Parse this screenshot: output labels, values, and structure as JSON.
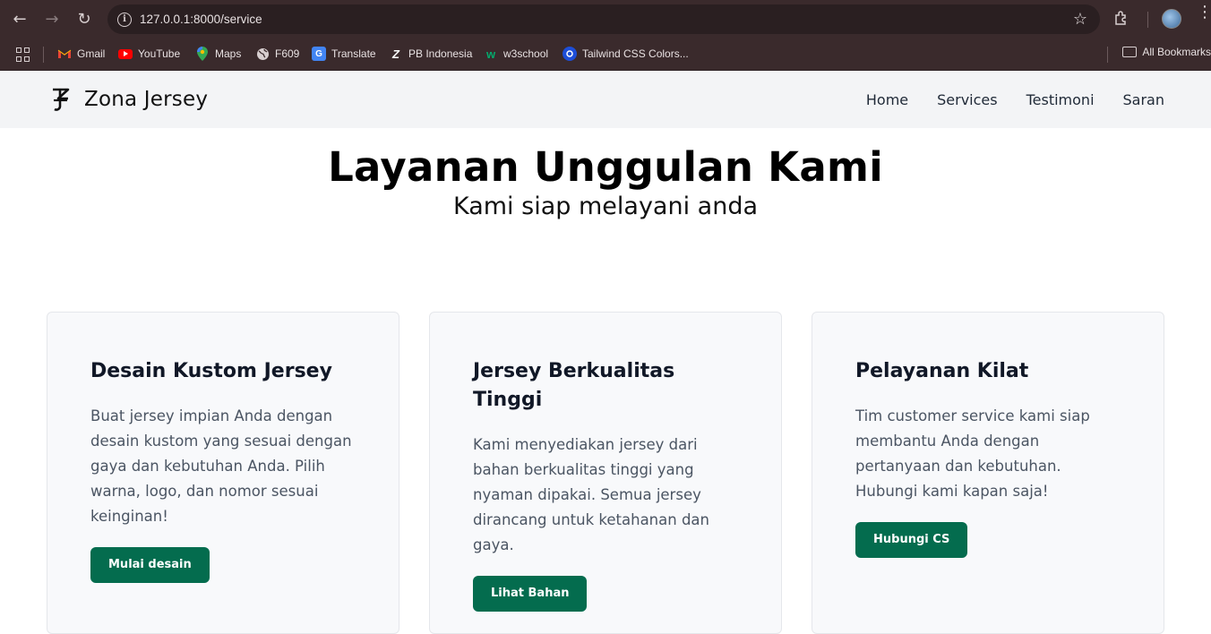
{
  "browser": {
    "url": "127.0.0.1:8000/service",
    "bookmarks": [
      {
        "label": "Gmail",
        "icon": "gmail-icon"
      },
      {
        "label": "YouTube",
        "icon": "youtube-icon"
      },
      {
        "label": "Maps",
        "icon": "maps-icon"
      },
      {
        "label": "F609",
        "icon": "globe-icon"
      },
      {
        "label": "Translate",
        "icon": "translate-icon"
      },
      {
        "label": "PB Indonesia",
        "icon": "pb-indonesia-icon"
      },
      {
        "label": "w3school",
        "icon": "w3school-icon"
      },
      {
        "label": "Tailwind CSS Colors...",
        "icon": "tailwind-icon"
      }
    ],
    "all_bookmarks": "All Bookmarks"
  },
  "site": {
    "brand": "Zona Jersey",
    "nav": [
      "Home",
      "Services",
      "Testimoni",
      "Saran"
    ]
  },
  "hero": {
    "title": "Layanan Unggulan Kami",
    "subtitle": "Kami siap melayani anda"
  },
  "cards": [
    {
      "title": "Desain Kustom Jersey",
      "text": "Buat jersey impian Anda dengan desain kustom yang sesuai dengan gaya dan kebutuhan Anda. Pilih warna, logo, dan nomor sesuai keinginan!",
      "button": "Mulai desain"
    },
    {
      "title": "Jersey Berkualitas Tinggi",
      "text": "Kami menyediakan jersey dari bahan berkualitas tinggi yang nyaman dipakai. Semua jersey dirancang untuk ketahanan dan gaya.",
      "button": "Lihat Bahan"
    },
    {
      "title": "Pelayanan Kilat",
      "text": "Tim customer service kami siap membantu Anda dengan pertanyaan dan kebutuhan. Hubungi kami kapan saja!",
      "button": "Hubungi CS"
    }
  ],
  "colors": {
    "primary_button": "#046c4e",
    "navbar_bg": "#f3f4f6",
    "card_bg": "#f8f9fb"
  }
}
